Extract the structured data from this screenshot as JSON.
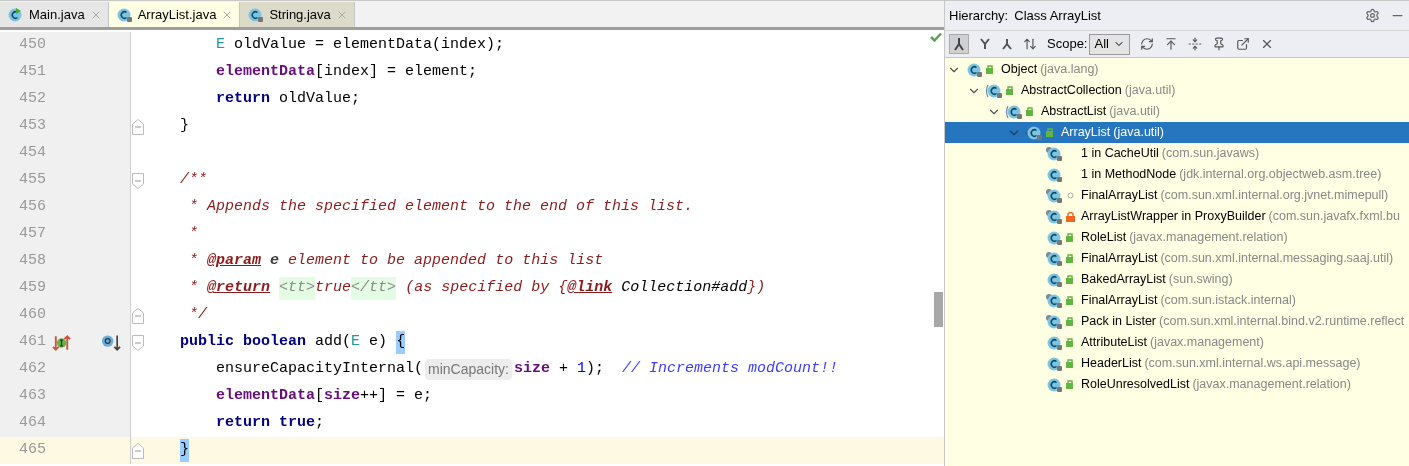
{
  "tabs": [
    {
      "label": "Main.java",
      "kind": "runnable",
      "selected": false
    },
    {
      "label": "ArrayList.java",
      "kind": "library",
      "selected": true
    },
    {
      "label": "String.java",
      "kind": "library",
      "selected": false
    }
  ],
  "editor": {
    "lines": [
      {
        "number": "450",
        "tokens": [
          {
            "text": "        E",
            "kind": "type"
          },
          {
            "text": " oldValue = elementData(index);",
            "kind": "plain"
          }
        ]
      },
      {
        "number": "451",
        "tokens": [
          {
            "text": "        elementData",
            "kind": "field"
          },
          {
            "text": "[index] = element;",
            "kind": "plain"
          }
        ]
      },
      {
        "number": "452",
        "tokens": [
          {
            "text": "        return",
            "kind": "keyword"
          },
          {
            "text": " oldValue;",
            "kind": "plain"
          }
        ]
      },
      {
        "number": "453",
        "fold": {
          "kind": "end"
        },
        "tokens": [
          {
            "text": "    }",
            "kind": "plain"
          }
        ]
      },
      {
        "number": "454"
      },
      {
        "number": "455",
        "fold": {
          "kind": "start"
        },
        "tokens": [
          {
            "text": "    /**",
            "kind": "doc"
          }
        ]
      },
      {
        "number": "456",
        "tokens": [
          {
            "text": "     * Appends the specified element to the end of this list.",
            "kind": "doc"
          }
        ]
      },
      {
        "number": "457",
        "tokens": [
          {
            "text": "     *",
            "kind": "doc"
          }
        ]
      },
      {
        "number": "458",
        "tokens": [
          {
            "text": "     * ",
            "kind": "doc"
          },
          {
            "text": "@param",
            "kind": "doctag"
          },
          {
            "text": " e",
            "kind": "docparam"
          },
          {
            "text": " element to be appended to this list",
            "kind": "doc"
          }
        ]
      },
      {
        "number": "459",
        "tokens": [
          {
            "text": "     * ",
            "kind": "doc"
          },
          {
            "text": "@return",
            "kind": "doctag"
          },
          {
            "text": " <tt>",
            "kind": "tt"
          },
          {
            "text": "true",
            "kind": "doc"
          },
          {
            "text": "</tt>",
            "kind": "tt"
          },
          {
            "text": " (as specified by {",
            "kind": "doc"
          },
          {
            "text": "@link",
            "kind": "doctag"
          },
          {
            "text": " Collection#add",
            "kind": "doclink"
          },
          {
            "text": "})",
            "kind": "doc"
          }
        ]
      },
      {
        "number": "460",
        "fold": {
          "kind": "end"
        },
        "tokens": [
          {
            "text": "     */",
            "kind": "doc"
          }
        ]
      },
      {
        "number": "461",
        "fold": {
          "kind": "start"
        },
        "markers": [
          {
            "kind": "implements"
          },
          {
            "kind": "overrides"
          }
        ],
        "tokens": [
          {
            "text": "    public boolean",
            "kind": "keyword"
          },
          {
            "text": " add(",
            "kind": "plain"
          },
          {
            "text": "E",
            "kind": "type"
          },
          {
            "text": " e) ",
            "kind": "plain"
          },
          {
            "text": "{",
            "kind": "brace"
          }
        ]
      },
      {
        "number": "462",
        "tokens": [
          {
            "text": "        ensureCapacityInternal(",
            "kind": "plain"
          },
          {
            "text": "minCapacity:",
            "kind": "hint"
          },
          {
            "text": "size",
            "kind": "field"
          },
          {
            "text": " + ",
            "kind": "plain"
          },
          {
            "text": "1",
            "kind": "number"
          },
          {
            "text": ");  ",
            "kind": "plain"
          },
          {
            "text": "// Increments modCount!!",
            "kind": "comment"
          }
        ]
      },
      {
        "number": "463",
        "tokens": [
          {
            "text": "        elementData",
            "kind": "field"
          },
          {
            "text": "[",
            "kind": "plain"
          },
          {
            "text": "size",
            "kind": "field"
          },
          {
            "text": "++] = e;",
            "kind": "plain"
          }
        ]
      },
      {
        "number": "464",
        "tokens": [
          {
            "text": "        return true",
            "kind": "keyword"
          },
          {
            "text": ";",
            "kind": "plain"
          }
        ]
      },
      {
        "number": "465",
        "fold": {
          "kind": "end"
        },
        "current": true,
        "tokens": [
          {
            "text": "    }",
            "kind": "brace"
          }
        ]
      }
    ]
  },
  "hierarchy": {
    "title": "Hierarchy:",
    "subject": "Class ArrayList",
    "scope_label": "Scope:",
    "scope_value": "All",
    "tree": [
      {
        "name": "Object",
        "package": "(java.lang)",
        "kind": "class",
        "modifier": {
          "kind": "public"
        },
        "expanded": true,
        "selected": false,
        "children": [
          {
            "name": "AbstractCollection",
            "package": "(java.util)",
            "kind": "abstract",
            "modifier": {
              "kind": "public"
            },
            "expanded": true,
            "selected": false,
            "children": [
              {
                "name": "AbstractList",
                "package": "(java.util)",
                "kind": "abstract",
                "modifier": {
                  "kind": "public"
                },
                "expanded": true,
                "selected": false,
                "children": [
                  {
                    "name": "ArrayList",
                    "package": "(java.util)",
                    "kind": "current",
                    "modifier": {
                      "kind": "public"
                    },
                    "expanded": true,
                    "selected": true,
                    "children": [
                      {
                        "name": "1 in CacheUtil",
                        "package": "(com.sun.javaws)",
                        "kind": "inner",
                        "selected": false
                      },
                      {
                        "name": "1 in MethodNode",
                        "package": "(jdk.internal.org.objectweb.asm.tree)",
                        "kind": "class",
                        "selected": false
                      },
                      {
                        "name": "FinalArrayList",
                        "package": "(com.sun.xml.internal.org.jvnet.mimepull)",
                        "kind": "inner",
                        "modifier": {
                          "kind": "package"
                        },
                        "selected": false
                      },
                      {
                        "name": "ArrayListWrapper in ProxyBuilder",
                        "package": "(com.sun.javafx.fxml.bu",
                        "kind": "inner",
                        "modifier": {
                          "kind": "private"
                        },
                        "selected": false
                      },
                      {
                        "name": "RoleList",
                        "package": "(javax.management.relation)",
                        "kind": "class",
                        "modifier": {
                          "kind": "public"
                        },
                        "selected": false
                      },
                      {
                        "name": "FinalArrayList",
                        "package": "(com.sun.xml.internal.messaging.saaj.util)",
                        "kind": "inner",
                        "modifier": {
                          "kind": "public"
                        },
                        "selected": false
                      },
                      {
                        "name": "BakedArrayList",
                        "package": "(sun.swing)",
                        "kind": "class",
                        "modifier": {
                          "kind": "public"
                        },
                        "selected": false
                      },
                      {
                        "name": "FinalArrayList",
                        "package": "(com.sun.istack.internal)",
                        "kind": "inner",
                        "modifier": {
                          "kind": "public"
                        },
                        "selected": false
                      },
                      {
                        "name": "Pack in Lister",
                        "package": "(com.sun.xml.internal.bind.v2.runtime.reflect",
                        "kind": "inner",
                        "modifier": {
                          "kind": "public"
                        },
                        "selected": false
                      },
                      {
                        "name": "AttributeList",
                        "package": "(javax.management)",
                        "kind": "class",
                        "modifier": {
                          "kind": "public"
                        },
                        "selected": false
                      },
                      {
                        "name": "HeaderList",
                        "package": "(com.sun.xml.internal.ws.api.message)",
                        "kind": "class",
                        "modifier": {
                          "kind": "public"
                        },
                        "selected": false
                      },
                      {
                        "name": "RoleUnresolvedList",
                        "package": "(javax.management.relation)",
                        "kind": "class",
                        "modifier": {
                          "kind": "public"
                        },
                        "selected": false
                      }
                    ]
                  }
                ]
              }
            ]
          }
        ]
      }
    ]
  }
}
